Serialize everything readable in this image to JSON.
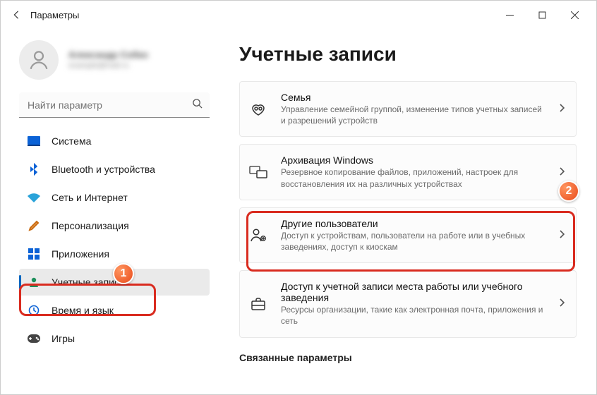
{
  "window": {
    "title": "Параметры"
  },
  "profile": {
    "name": "Александр Собко",
    "email": "example@mail.ru"
  },
  "search": {
    "placeholder": "Найти параметр"
  },
  "sidebar": {
    "items": [
      {
        "label": "Система",
        "icon": "system",
        "active": false
      },
      {
        "label": "Bluetooth и устройства",
        "icon": "bluetooth",
        "active": false
      },
      {
        "label": "Сеть и Интернет",
        "icon": "wifi",
        "active": false
      },
      {
        "label": "Персонализация",
        "icon": "brush",
        "active": false
      },
      {
        "label": "Приложения",
        "icon": "apps",
        "active": false
      },
      {
        "label": "Учетные записи",
        "icon": "person",
        "active": true
      },
      {
        "label": "Время и язык",
        "icon": "clock",
        "active": false
      },
      {
        "label": "Игры",
        "icon": "game",
        "active": false
      }
    ]
  },
  "page": {
    "heading": "Учетные записи",
    "relatedHeading": "Связанные параметры",
    "cards": [
      {
        "title": "Семья",
        "desc": "Управление семейной группой, изменение типов учетных записей и разрешений устройств",
        "icon": "family"
      },
      {
        "title": "Архивация Windows",
        "desc": "Резервное копирование файлов, приложений, настроек для восстановления их на различных устройствах",
        "icon": "backup"
      },
      {
        "title": "Другие пользователи",
        "desc": "Доступ к устройствам, пользователи на работе или в учебных заведениях, доступ к киоскам",
        "icon": "otherusers"
      },
      {
        "title": "Доступ к учетной записи места работы или учебного заведения",
        "desc": "Ресурсы организации, такие как электронная почта, приложения и сеть",
        "icon": "briefcase"
      }
    ]
  },
  "annotations": {
    "badge1": "1",
    "badge2": "2"
  }
}
